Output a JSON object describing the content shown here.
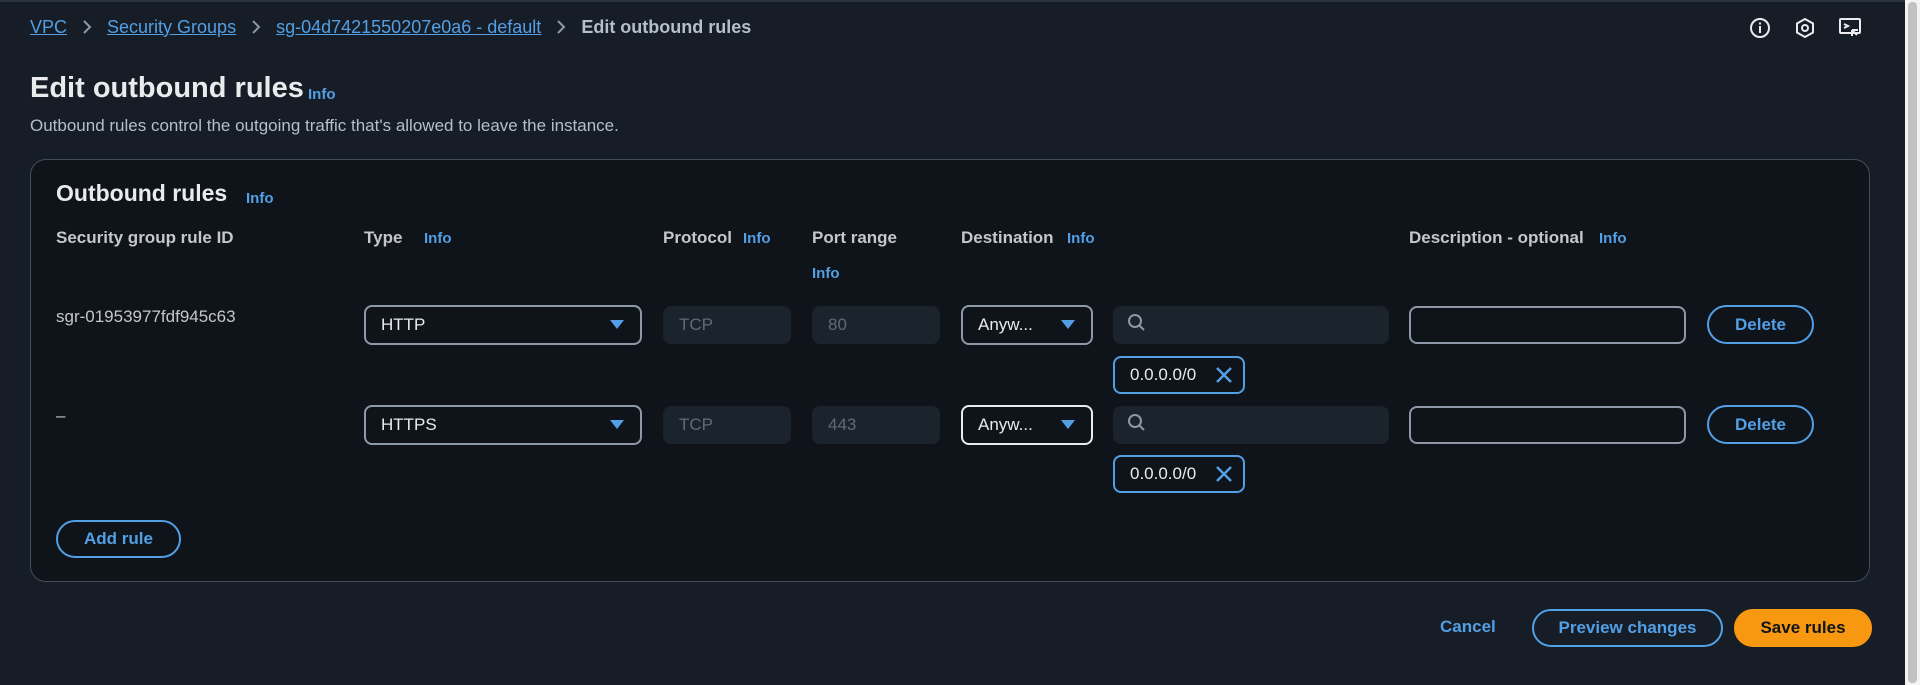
{
  "breadcrumb": {
    "items": [
      "VPC",
      "Security Groups",
      "sg-04d7421550207e0a6 - default"
    ],
    "current": "Edit outbound rules"
  },
  "header_icons": [
    "info-circle-icon",
    "hexagon-settings-icon",
    "monitor-feedback-icon"
  ],
  "page": {
    "title": "Edit outbound rules",
    "info": "Info",
    "description": "Outbound rules control the outgoing traffic that's allowed to leave the instance."
  },
  "panel": {
    "title": "Outbound rules",
    "info": "Info",
    "columns": {
      "rule_id": "Security group rule ID",
      "type": "Type",
      "protocol": "Protocol",
      "port_range": "Port range",
      "destination": "Destination",
      "description": "Description - optional"
    },
    "info_label": "Info",
    "rules": [
      {
        "rule_id": "sgr-01953977fdf945c63",
        "type": "HTTP",
        "protocol": "TCP",
        "port": "80",
        "destination": "Anyw...",
        "cidr": "0.0.0.0/0",
        "description_value": "",
        "delete_label": "Delete"
      },
      {
        "rule_id": "–",
        "type": "HTTPS",
        "protocol": "TCP",
        "port": "443",
        "destination": "Anyw...",
        "cidr": "0.0.0.0/0",
        "description_value": "",
        "delete_label": "Delete"
      }
    ],
    "add_rule_label": "Add rule"
  },
  "footer": {
    "cancel_label": "Cancel",
    "preview_label": "Preview changes",
    "save_label": "Save rules"
  },
  "colors": {
    "background": "#161d26",
    "panel": "#0f141a",
    "link": "#539fe5",
    "primary": "#f89810"
  }
}
